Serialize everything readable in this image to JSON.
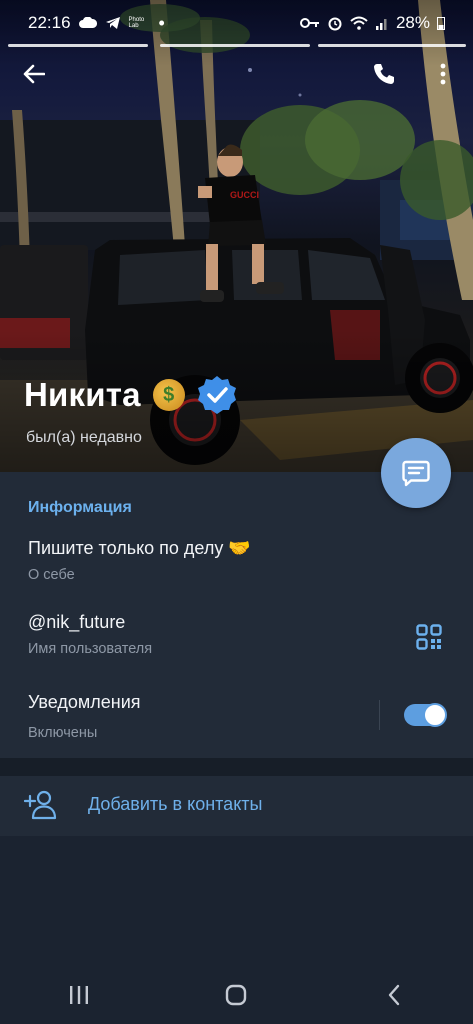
{
  "status_bar": {
    "time": "22:16",
    "app_badge": "Photo Lab",
    "battery": "28%"
  },
  "profile": {
    "name": "Никита",
    "last_seen": "был(а) недавно",
    "emoji_status_icon": "money-bag-icon"
  },
  "info": {
    "section_title": "Информация",
    "bio": "Пишите только по делу 🤝",
    "bio_label": "О себе",
    "username": "@nik_future",
    "username_label": "Имя пользователя",
    "notifications": "Уведомления",
    "notifications_state": "Включены",
    "notifications_enabled": true
  },
  "actions": {
    "add_contact": "Добавить в контакты"
  },
  "colors": {
    "accent": "#6cb1ee",
    "fab": "#7aa8dd",
    "background": "#1b2330",
    "card": "#222b38",
    "verified": "#3f8fe8"
  }
}
